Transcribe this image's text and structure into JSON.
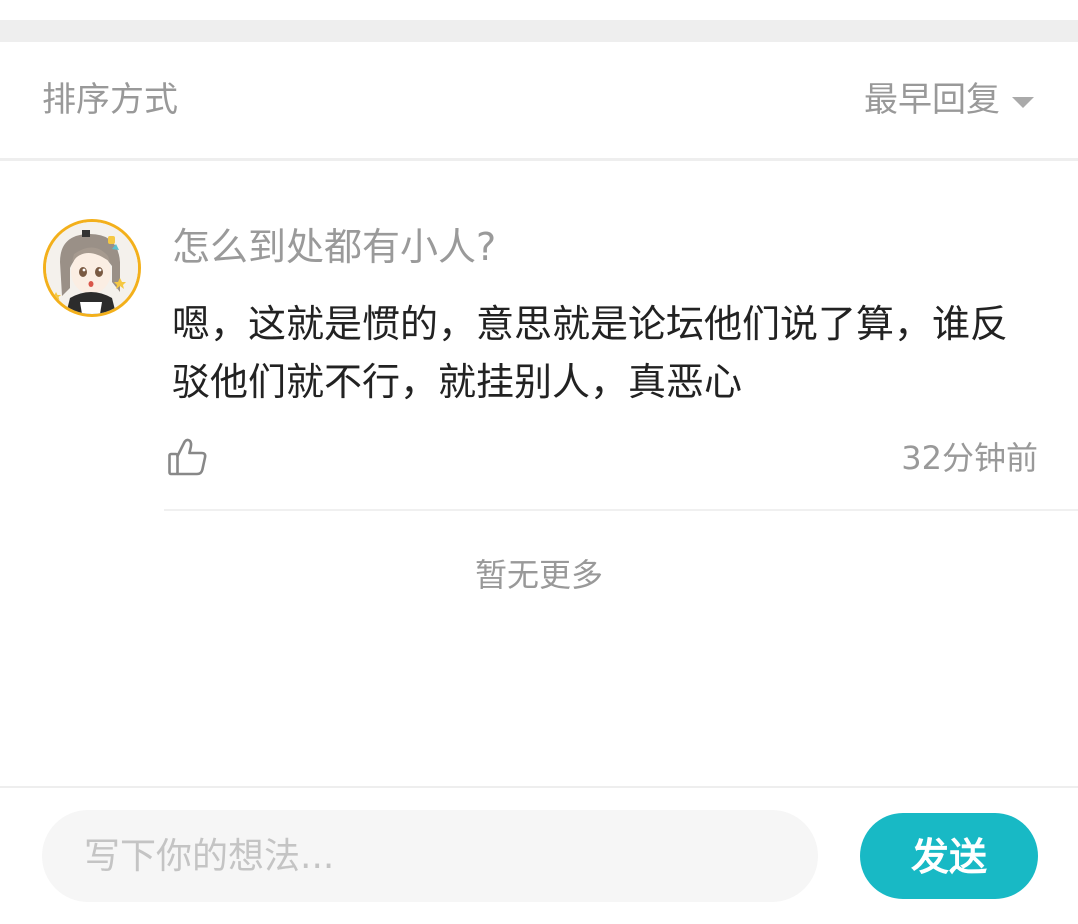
{
  "sort": {
    "label": "排序方式",
    "selected": "最早回复"
  },
  "comment": {
    "avatar": "user-avatar-anime-girl",
    "quote": "怎么到处都有小人?",
    "text": "嗯，这就是惯的，意思就是论坛他们说了算，谁反驳他们就不行，就挂别人，真恶心",
    "time": "32分钟前",
    "like_icon": "thumbs-up-icon"
  },
  "footer_note": "暂无更多",
  "composer": {
    "placeholder": "写下你的想法...",
    "send_label": "发送"
  },
  "colors": {
    "accent": "#18b9c5",
    "avatar_border": "#f3b01b",
    "muted_text": "#999999",
    "band": "#eeeeee"
  }
}
